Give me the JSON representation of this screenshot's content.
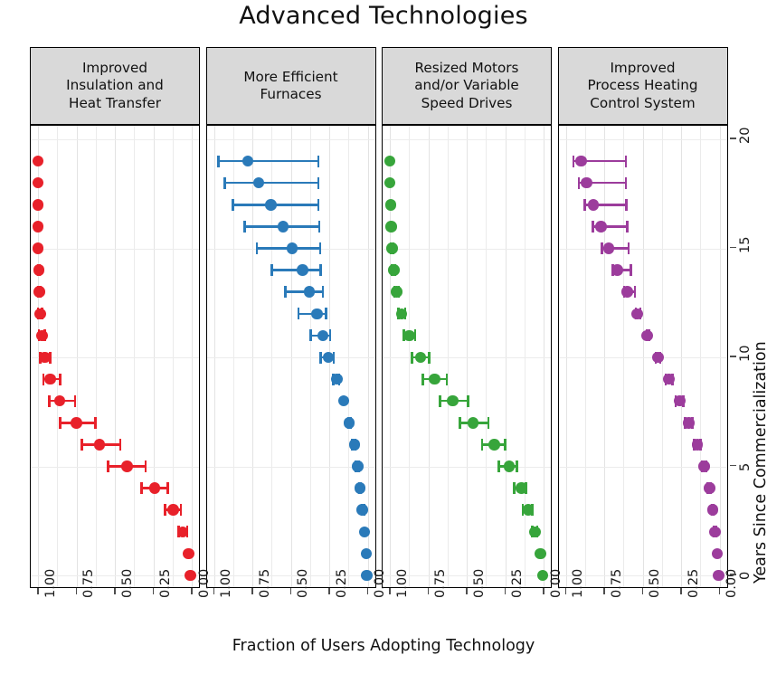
{
  "chart_data": {
    "type": "scatter",
    "title": "Advanced Technologies",
    "xlabel": "Fraction of Users Adopting Technology",
    "ylabel": "Years Since Commercialization",
    "xlim": [
      1.0,
      0.0
    ],
    "x_reversed": true,
    "ylim": [
      -0.6,
      20.5
    ],
    "grid": true,
    "legend": "none",
    "xticks": [
      "1.00",
      "0.75",
      "0.50",
      "0.25",
      "0.00"
    ],
    "xtick_values": [
      1.0,
      0.75,
      0.5,
      0.25,
      0.0
    ],
    "yticks": [
      "0",
      "5",
      "10",
      "15",
      "20"
    ],
    "ytick_values": [
      0,
      5,
      10,
      15,
      20
    ],
    "error_bars": "horizontal 95% interval",
    "marker": "filled circle",
    "panels": [
      {
        "label": "Improved\nInsulation and\nHeat Transfer",
        "color": "#e8212a",
        "y": [
          0,
          1,
          2,
          3,
          4,
          5,
          6,
          7,
          8,
          9,
          10,
          11,
          12,
          13,
          14,
          15,
          16,
          17,
          18,
          19
        ],
        "values": [
          0.01,
          0.02,
          0.06,
          0.12,
          0.24,
          0.42,
          0.6,
          0.75,
          0.86,
          0.92,
          0.955,
          0.975,
          0.985,
          0.99,
          0.995,
          1.0,
          1.0,
          1.0,
          1.0,
          1.0
        ],
        "lo": [
          0.01,
          0.02,
          0.03,
          0.07,
          0.155,
          0.3,
          0.465,
          0.625,
          0.76,
          0.855,
          0.92,
          0.955,
          0.975,
          0.985,
          0.99,
          1.0,
          1.0,
          1.0,
          1.0,
          1.0
        ],
        "hi": [
          0.01,
          0.02,
          0.085,
          0.175,
          0.325,
          0.545,
          0.715,
          0.855,
          0.925,
          0.965,
          0.985,
          0.995,
          1.0,
          1.0,
          1.0,
          1.0,
          1.0,
          1.0,
          1.0,
          1.0
        ]
      },
      {
        "label": "More Efficient\nFurnaces",
        "color": "#2a7ab9",
        "y": [
          0,
          1,
          2,
          3,
          4,
          5,
          6,
          7,
          8,
          9,
          10,
          11,
          12,
          13,
          14,
          15,
          16,
          17,
          18,
          19
        ],
        "values": [
          0.005,
          0.01,
          0.02,
          0.035,
          0.05,
          0.065,
          0.085,
          0.12,
          0.155,
          0.2,
          0.255,
          0.29,
          0.33,
          0.38,
          0.425,
          0.49,
          0.55,
          0.63,
          0.71,
          0.78
        ],
        "lo": [
          0.005,
          0.01,
          0.02,
          0.025,
          0.045,
          0.055,
          0.08,
          0.11,
          0.16,
          0.225,
          0.305,
          0.37,
          0.45,
          0.535,
          0.625,
          0.72,
          0.8,
          0.875,
          0.93,
          0.97
        ],
        "hi": [
          0.005,
          0.01,
          0.02,
          0.035,
          0.055,
          0.075,
          0.1,
          0.125,
          0.155,
          0.185,
          0.22,
          0.245,
          0.27,
          0.29,
          0.305,
          0.31,
          0.315,
          0.32,
          0.32,
          0.32
        ]
      },
      {
        "label": "Resized Motors\nand/or Variable\nSpeed Drives",
        "color": "#37a53b",
        "y": [
          0,
          1,
          2,
          3,
          4,
          5,
          6,
          7,
          8,
          9,
          10,
          11,
          12,
          13,
          14,
          15,
          16,
          17,
          18,
          19
        ],
        "values": [
          0.005,
          0.02,
          0.055,
          0.1,
          0.145,
          0.225,
          0.32,
          0.46,
          0.59,
          0.71,
          0.8,
          0.875,
          0.925,
          0.955,
          0.975,
          0.985,
          0.99,
          0.995,
          1.0,
          1.0
        ],
        "lo": [
          0.005,
          0.02,
          0.04,
          0.075,
          0.115,
          0.175,
          0.25,
          0.36,
          0.49,
          0.63,
          0.745,
          0.835,
          0.9,
          0.94,
          0.965,
          0.98,
          0.99,
          0.995,
          1.0,
          1.0
        ],
        "hi": [
          0.005,
          0.02,
          0.075,
          0.135,
          0.19,
          0.29,
          0.4,
          0.545,
          0.675,
          0.785,
          0.855,
          0.91,
          0.945,
          0.97,
          0.985,
          0.99,
          0.995,
          1.0,
          1.0,
          1.0
        ]
      },
      {
        "label": "Improved\nProcess Heating\nControl System",
        "color": "#9c3c9c",
        "y": [
          0,
          1,
          2,
          3,
          4,
          5,
          6,
          7,
          8,
          9,
          10,
          11,
          12,
          13,
          14,
          15,
          16,
          17,
          18,
          19
        ],
        "values": [
          0.005,
          0.015,
          0.03,
          0.045,
          0.065,
          0.1,
          0.145,
          0.2,
          0.26,
          0.33,
          0.4,
          0.47,
          0.535,
          0.6,
          0.665,
          0.72,
          0.77,
          0.82,
          0.865,
          0.9
        ],
        "lo": [
          0.005,
          0.015,
          0.025,
          0.04,
          0.055,
          0.085,
          0.125,
          0.175,
          0.235,
          0.305,
          0.385,
          0.46,
          0.545,
          0.62,
          0.695,
          0.765,
          0.825,
          0.875,
          0.915,
          0.95
        ],
        "hi": [
          0.005,
          0.015,
          0.035,
          0.05,
          0.075,
          0.115,
          0.165,
          0.225,
          0.285,
          0.35,
          0.415,
          0.47,
          0.515,
          0.55,
          0.575,
          0.59,
          0.6,
          0.605,
          0.61,
          0.61
        ]
      }
    ]
  }
}
